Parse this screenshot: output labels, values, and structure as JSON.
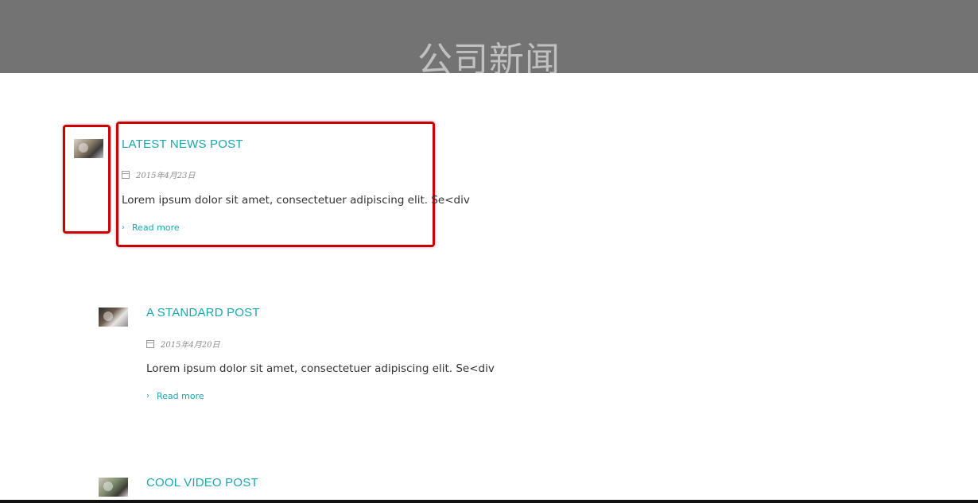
{
  "hero": {
    "title": "公司新闻"
  },
  "posts": [
    {
      "title": "LATEST NEWS POST",
      "date": "2015年4月23日",
      "excerpt": "Lorem ipsum dolor sit amet, consectetuer adipiscing elit. Se<div",
      "read_more": "Read more"
    },
    {
      "title": "A STANDARD POST",
      "date": "2015年4月20日",
      "excerpt": "Lorem ipsum dolor sit amet, consectetuer adipiscing elit. Se<div",
      "read_more": "Read more"
    },
    {
      "title": "COOL VIDEO POST"
    }
  ],
  "colors": {
    "accent": "#1aa6b0",
    "hero_bg": "#737373",
    "highlight": "#cc0000"
  },
  "icons": {
    "date": "calendar-icon",
    "read_more": "chevron-right-icon"
  }
}
